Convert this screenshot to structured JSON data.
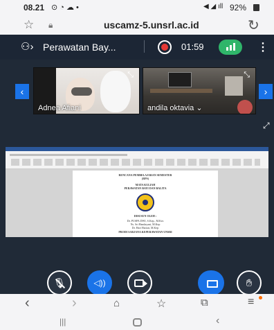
{
  "status_bar": {
    "time": "08.21",
    "battery": "92%"
  },
  "browser": {
    "url": "uscamz-5.unsrl.ac.id"
  },
  "meeting": {
    "title": "Perawatan Bay...",
    "timer": "01:59",
    "participants": [
      {
        "name": "Adnea Afiani"
      },
      {
        "name": "andila oktavia"
      }
    ]
  },
  "shared_document": {
    "lines": [
      "RENCANA PEMBELAJARAN SEMESTER",
      "(RPS)",
      "MATA KULIAH",
      "PERAWATAN BAYI DAN BALITA",
      "DISUSUN OLEH :",
      "Dr. PUSPA DWI, S.Kep., M.Kes",
      "Ns. Sri Handayani, M.Kep",
      "Dr. Hari Hartati, M.Kep",
      "PRODI SARJANA KEPERAWATAN UNSRI"
    ]
  },
  "colors": {
    "meeting_bg": "#202a37",
    "accent_blue": "#1a73e8",
    "record_red": "#e53935",
    "signal_green": "#2fb56a"
  }
}
